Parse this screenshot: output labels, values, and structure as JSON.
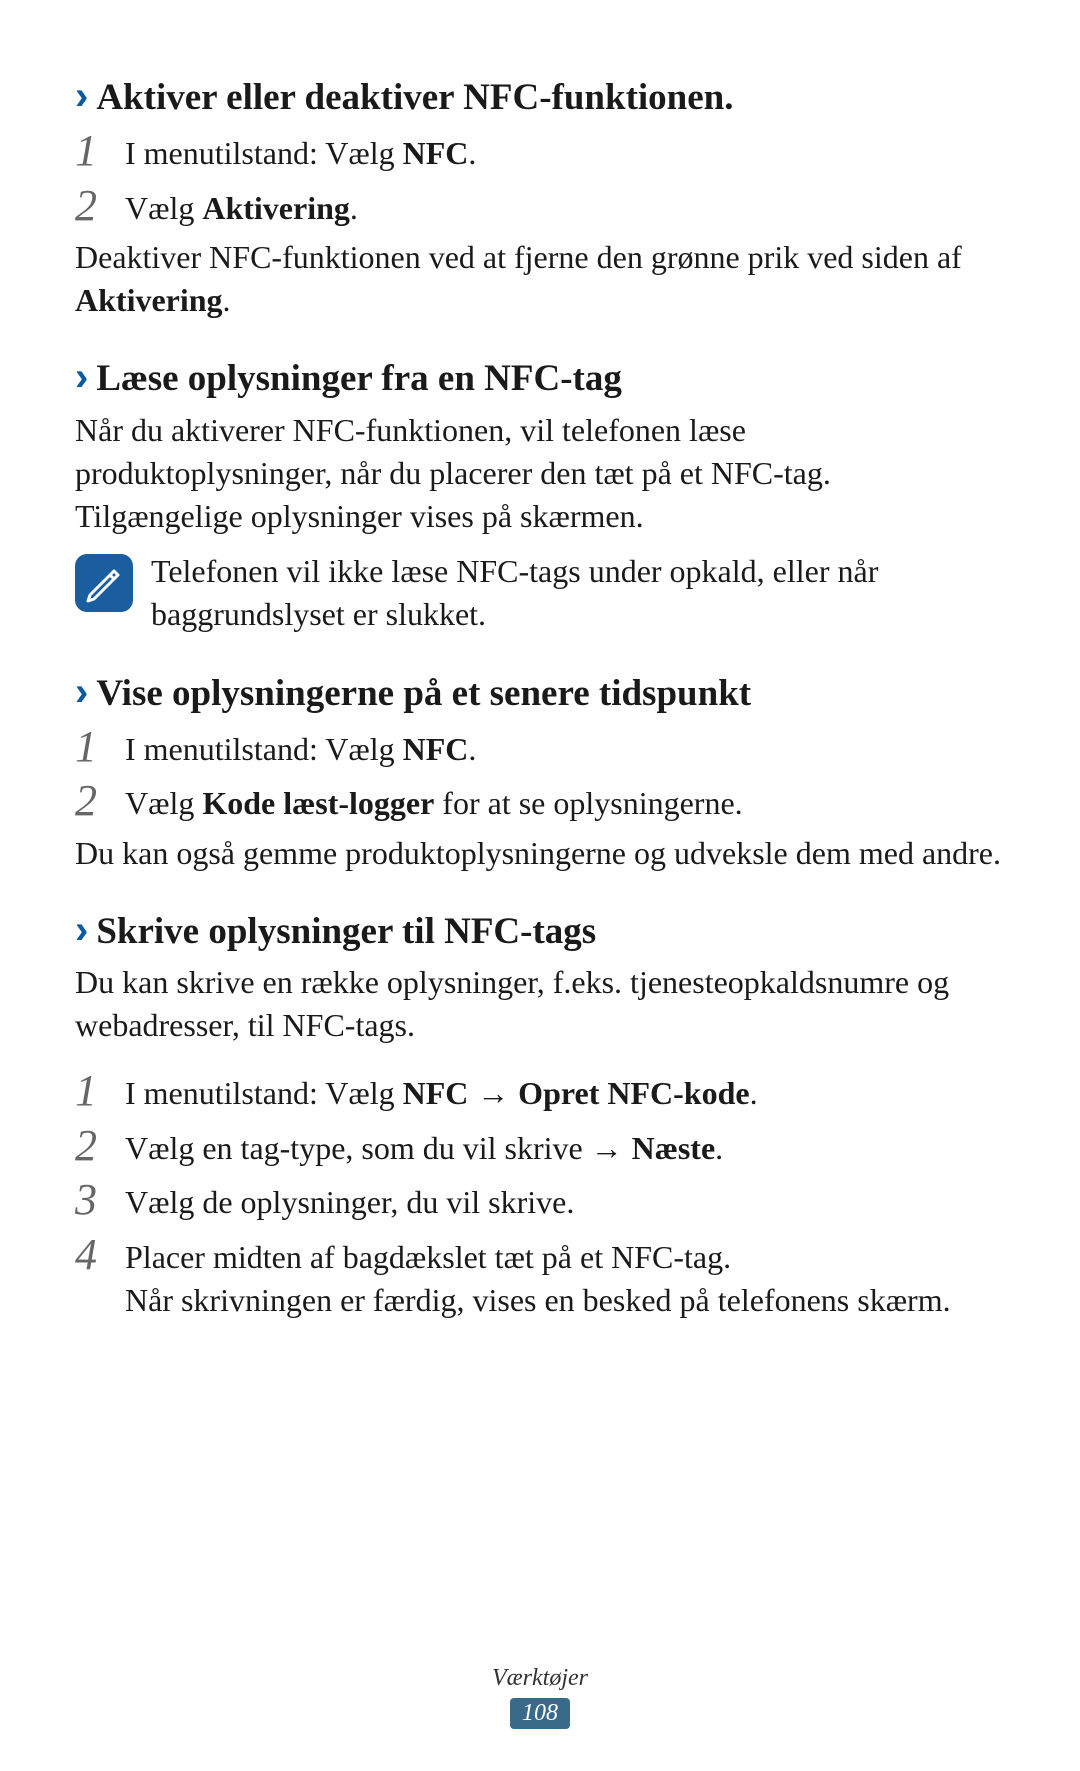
{
  "sections": [
    {
      "heading": "Aktiver eller deaktiver NFC-funktionen.",
      "steps": [
        {
          "num": "1",
          "prefix": "I menutilstand: Vælg ",
          "bold": "NFC",
          "suffix": "."
        },
        {
          "num": "2",
          "prefix": "Vælg ",
          "bold": "Aktivering",
          "suffix": "."
        }
      ],
      "after_prefix": "Deaktiver NFC-funktionen ved at fjerne den grønne prik ved siden af ",
      "after_bold": "Aktivering",
      "after_suffix": "."
    },
    {
      "heading": "Læse oplysninger fra en NFC-tag",
      "para": "Når du aktiverer NFC-funktionen, vil telefonen læse produktoplysninger, når du placerer den tæt på et NFC-tag. Tilgængelige oplysninger vises på skærmen.",
      "note": "Telefonen vil ikke læse NFC-tags under opkald, eller når baggrundslyset er slukket."
    },
    {
      "heading": "Vise oplysningerne på et senere tidspunkt",
      "steps": [
        {
          "num": "1",
          "prefix": "I menutilstand: Vælg ",
          "bold": "NFC",
          "suffix": "."
        },
        {
          "num": "2",
          "prefix": "Vælg ",
          "bold": "Kode læst-logger",
          "suffix": " for at se oplysningerne."
        }
      ],
      "after": "Du kan også gemme produktoplysningerne og udveksle dem med andre."
    },
    {
      "heading": "Skrive oplysninger til NFC-tags",
      "para": "Du kan skrive en række oplysninger, f.eks. tjenesteopkaldsnumre og webadresser, til NFC-tags.",
      "steps4": {
        "s1": {
          "num": "1",
          "pre": "I menutilstand: Vælg ",
          "b1": "NFC",
          "arrow": " → ",
          "b2": "Opret NFC-kode",
          "post": "."
        },
        "s2": {
          "num": "2",
          "pre": "Vælg en tag-type, som du vil skrive ",
          "arrow": "→ ",
          "b": "Næste",
          "post": "."
        },
        "s3": {
          "num": "3",
          "text": "Vælg de oplysninger, du vil skrive."
        },
        "s4": {
          "num": "4",
          "line1": "Placer midten af bagdækslet tæt på et NFC-tag.",
          "line2": "Når skrivningen er færdig, vises en besked på telefonens skærm."
        }
      }
    }
  ],
  "footer": {
    "label": "Værktøjer",
    "page": "108"
  }
}
